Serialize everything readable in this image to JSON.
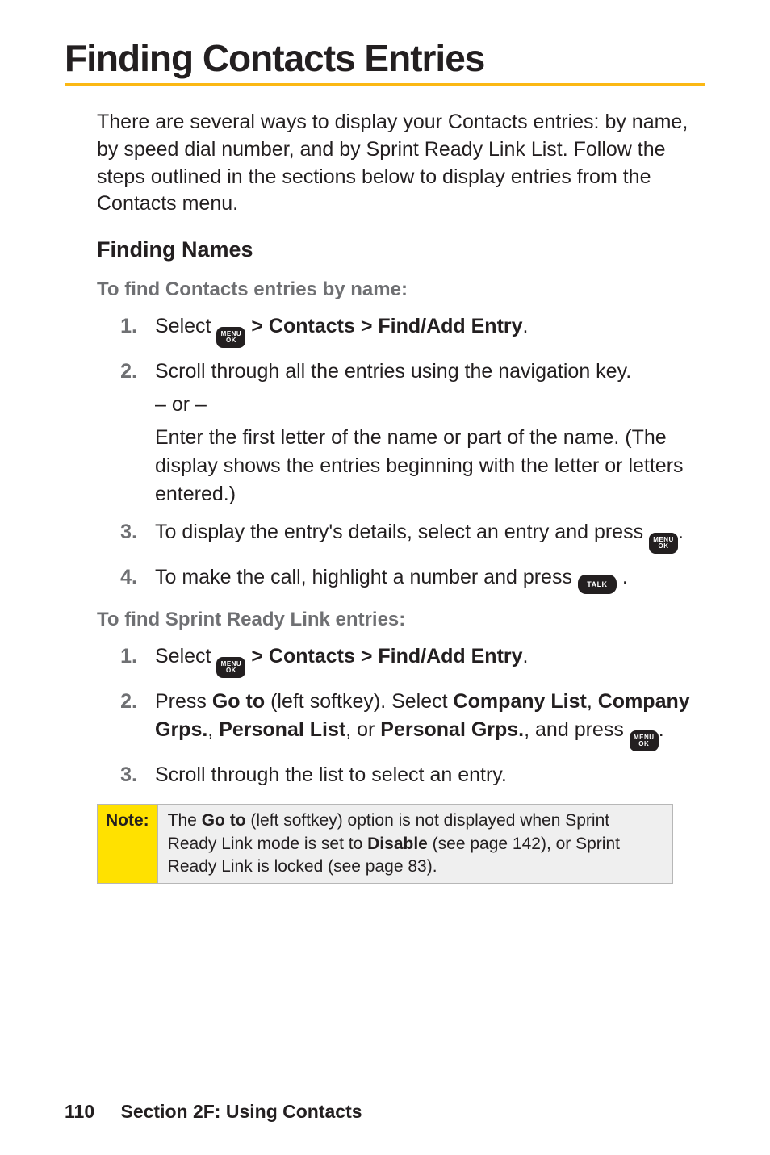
{
  "title": "Finding Contacts Entries",
  "intro": "There are several ways to display your Contacts entries: by name, by speed dial number, and by Sprint Ready Link List. Follow the steps outlined in the sections below to display entries from the Contacts menu.",
  "subhead": "Finding Names",
  "lead1": "To find Contacts entries by name:",
  "steps1": {
    "s1": {
      "num": "1.",
      "pre": "Select ",
      "bold": " > Contacts > Find/Add Entry",
      "post": "."
    },
    "s2": {
      "num": "2.",
      "line1": "Scroll through all the entries using the navigation key.",
      "or": "– or –",
      "line2": "Enter the first letter of the name or part of the name. (The display shows the entries beginning with the letter or letters entered.)"
    },
    "s3": {
      "num": "3.",
      "pre": "To display the entry's details, select an entry and press ",
      "post": "."
    },
    "s4": {
      "num": "4.",
      "pre": "To make the call, highlight a number and press ",
      "post": " ."
    }
  },
  "lead2": "To find Sprint Ready Link entries:",
  "steps2": {
    "s1": {
      "num": "1.",
      "pre": "Select ",
      "bold": " > Contacts > Find/Add Entry",
      "post": "."
    },
    "s2": {
      "num": "2.",
      "p1": "Press ",
      "b1": "Go to",
      "p2": " (left softkey). Select ",
      "b2": "Company List",
      "p3": ", ",
      "b3": "Company Grps.",
      "p4": ", ",
      "b4": "Personal List",
      "p5": ", or ",
      "b5": "Personal Grps.",
      "p6": ", and press ",
      "post": "."
    },
    "s3": {
      "num": "3.",
      "text": "Scroll through the list to select an entry."
    }
  },
  "note": {
    "label": "Note:",
    "p1": "The ",
    "b1": "Go to",
    "p2": " (left softkey) option is not displayed when Sprint Ready Link mode is set to ",
    "b2": "Disable",
    "p3": " (see page 142), or Sprint Ready Link is locked (see page 83)."
  },
  "footer": {
    "page": "110",
    "section": "Section 2F: Using Contacts"
  },
  "icons": {
    "menu_line1": "MENU",
    "menu_line2": "OK",
    "talk": "TALK"
  }
}
